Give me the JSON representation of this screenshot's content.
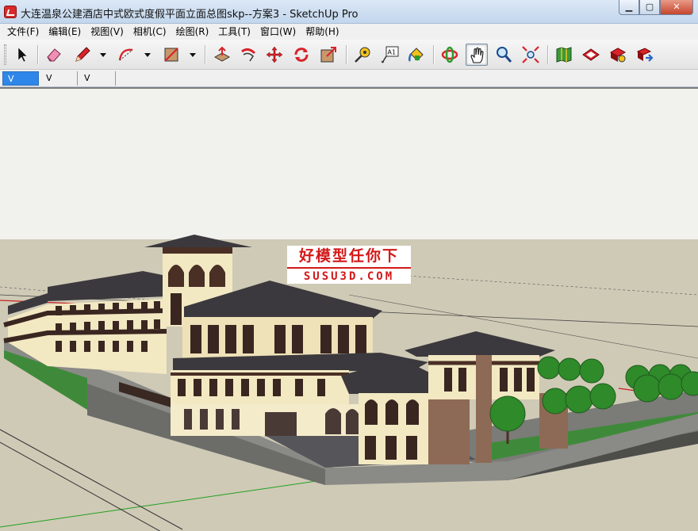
{
  "window": {
    "title": "大连温泉公建酒店中式欧式度假平面立面总图skp--方案3 - SketchUp Pro",
    "buttons": {
      "minimize": "▁",
      "maximize": "▢",
      "close": "✕"
    }
  },
  "menu": {
    "items": [
      {
        "label": "文件(F)"
      },
      {
        "label": "编辑(E)"
      },
      {
        "label": "视图(V)"
      },
      {
        "label": "相机(C)"
      },
      {
        "label": "绘图(R)"
      },
      {
        "label": "工具(T)"
      },
      {
        "label": "窗口(W)"
      },
      {
        "label": "帮助(H)"
      }
    ]
  },
  "toolbar": {
    "tools": [
      {
        "name": "select-tool",
        "icon": "arrow-cursor-icon"
      },
      {
        "name": "eraser-tool",
        "icon": "eraser-icon"
      },
      {
        "name": "pencil-tool",
        "icon": "pencil-icon"
      },
      {
        "name": "arc-tool",
        "icon": "arc-icon"
      },
      {
        "name": "rectangle-tool",
        "icon": "rectangle-icon"
      },
      {
        "name": "push-pull-tool",
        "icon": "push-pull-icon"
      },
      {
        "name": "follow-me-tool",
        "icon": "follow-me-icon"
      },
      {
        "name": "move-tool",
        "icon": "move-icon"
      },
      {
        "name": "rotate-tool",
        "icon": "rotate-icon"
      },
      {
        "name": "scale-tool",
        "icon": "scale-icon"
      },
      {
        "name": "tape-measure-tool",
        "icon": "tape-measure-icon"
      },
      {
        "name": "text-tool",
        "icon": "text-icon",
        "label": "A1"
      },
      {
        "name": "paint-bucket-tool",
        "icon": "paint-bucket-icon"
      },
      {
        "name": "orbit-tool",
        "icon": "orbit-icon"
      },
      {
        "name": "pan-tool",
        "icon": "hand-icon",
        "active": true
      },
      {
        "name": "zoom-tool",
        "icon": "magnifier-icon"
      },
      {
        "name": "zoom-extents-tool",
        "icon": "zoom-extents-icon"
      },
      {
        "name": "map-tool",
        "icon": "map-icon"
      },
      {
        "name": "warehouse-tool",
        "icon": "warehouse-icon"
      },
      {
        "name": "components-tool",
        "icon": "components-icon"
      },
      {
        "name": "share-tool",
        "icon": "share-icon"
      }
    ]
  },
  "tabs": [
    {
      "label": "V",
      "active": true
    },
    {
      "label": "V",
      "active": false
    },
    {
      "label": "V",
      "active": false
    }
  ],
  "watermark": {
    "line1": "好模型任你下",
    "line2": "SUSU3D.COM"
  },
  "colors": {
    "sky": "#f2f2ee",
    "ground": "#cfcab7",
    "roof": "#3d3b3f",
    "wall": "#f3e9c3",
    "trim": "#4a2f25",
    "tree": "#2f8a2a",
    "accent_red": "#d31818"
  }
}
